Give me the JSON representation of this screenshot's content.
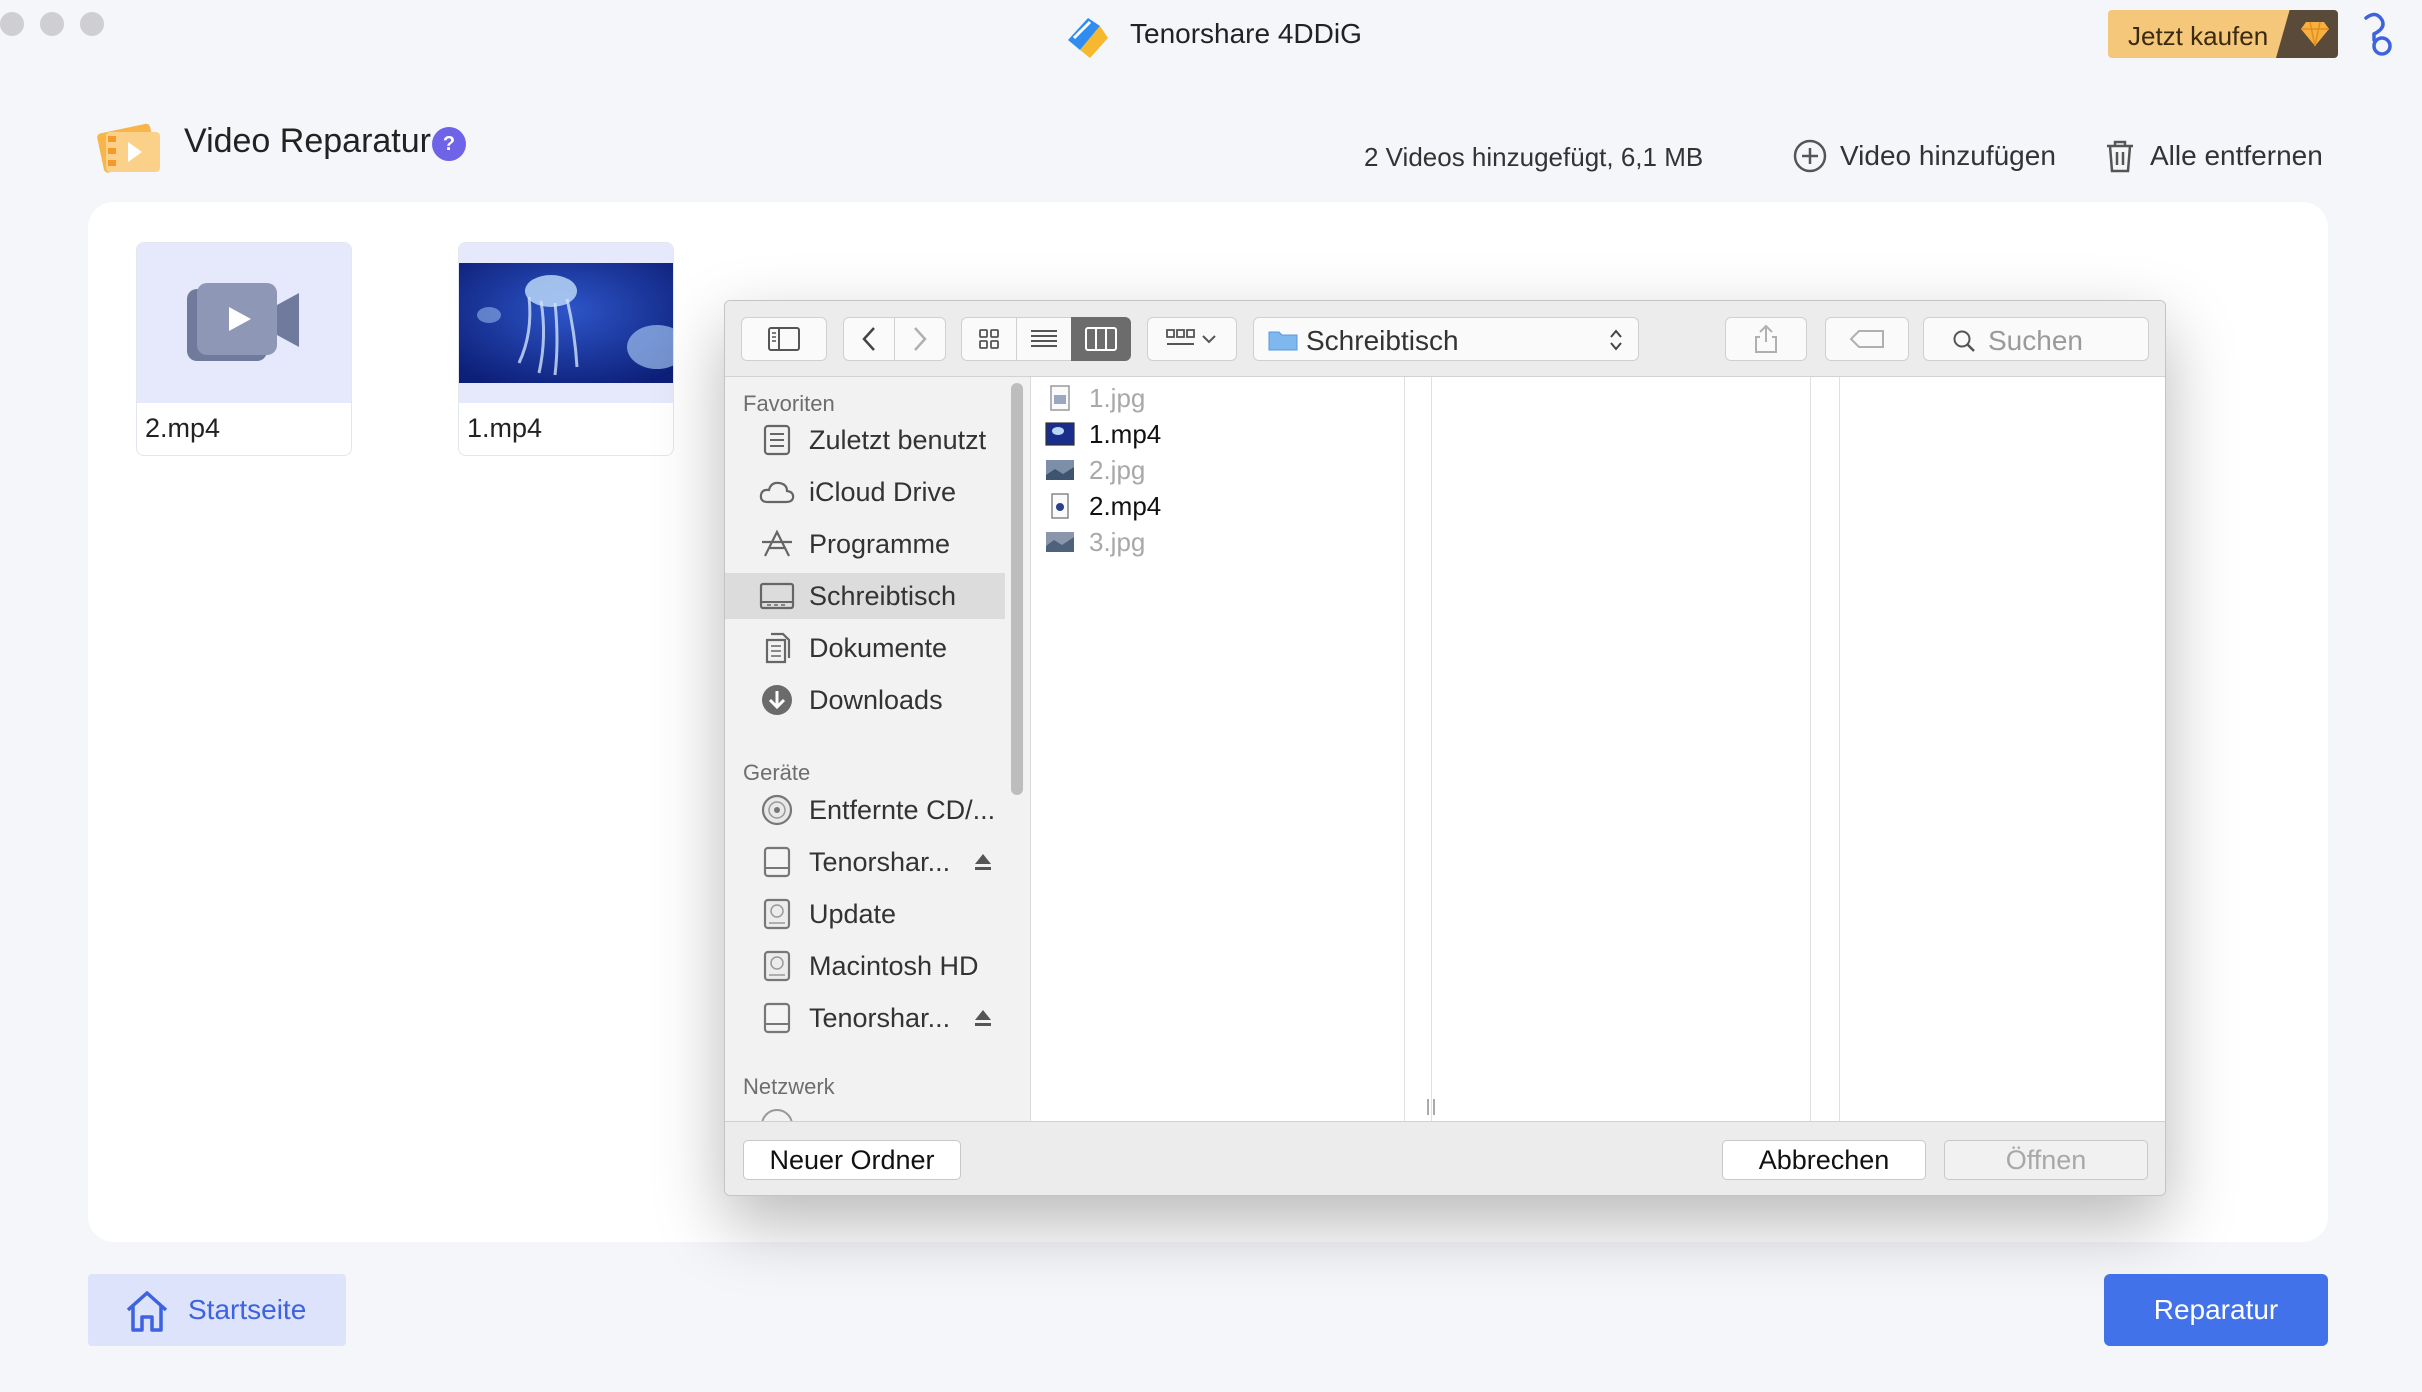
{
  "app": {
    "title": "Tenorshare 4DDiG",
    "buy_label": "Jetzt kaufen",
    "accent": "#4172ea"
  },
  "header": {
    "title": "Video Reparatur",
    "help_label": "?",
    "count_text": "2 Videos hinzugefügt, 6,1 MB",
    "add_label": "Video hinzufügen",
    "remove_label": "Alle entfernen"
  },
  "videos": [
    {
      "name": "2.mp4"
    },
    {
      "name": "1.mp4"
    }
  ],
  "dialog": {
    "location": "Schreibtisch",
    "search_placeholder": "Suchen",
    "sidebar": {
      "favorites_header": "Favoriten",
      "favorites": [
        {
          "label": "Zuletzt benutzt",
          "icon": "recents-icon"
        },
        {
          "label": "iCloud Drive",
          "icon": "cloud-icon"
        },
        {
          "label": "Programme",
          "icon": "applications-icon"
        },
        {
          "label": "Schreibtisch",
          "icon": "desktop-icon"
        },
        {
          "label": "Dokumente",
          "icon": "documents-icon"
        },
        {
          "label": "Downloads",
          "icon": "downloads-icon"
        }
      ],
      "devices_header": "Geräte",
      "devices": [
        {
          "label": "Entfernte CD/...",
          "icon": "cd-icon"
        },
        {
          "label": "Tenorshar...",
          "icon": "drive-icon"
        },
        {
          "label": "Update",
          "icon": "disk-icon"
        },
        {
          "label": "Macintosh HD",
          "icon": "disk-icon"
        },
        {
          "label": "Tenorshar...",
          "icon": "drive-icon"
        }
      ],
      "network_header": "Netzwerk"
    },
    "files": [
      {
        "name": "1.jpg",
        "enabled": false
      },
      {
        "name": "1.mp4",
        "enabled": true
      },
      {
        "name": "2.jpg",
        "enabled": false
      },
      {
        "name": "2.mp4",
        "enabled": true
      },
      {
        "name": "3.jpg",
        "enabled": false
      }
    ],
    "new_folder_label": "Neuer Ordner",
    "cancel_label": "Abbrechen",
    "open_label": "Öffnen"
  },
  "footer": {
    "home_label": "Startseite",
    "repair_label": "Reparatur"
  }
}
